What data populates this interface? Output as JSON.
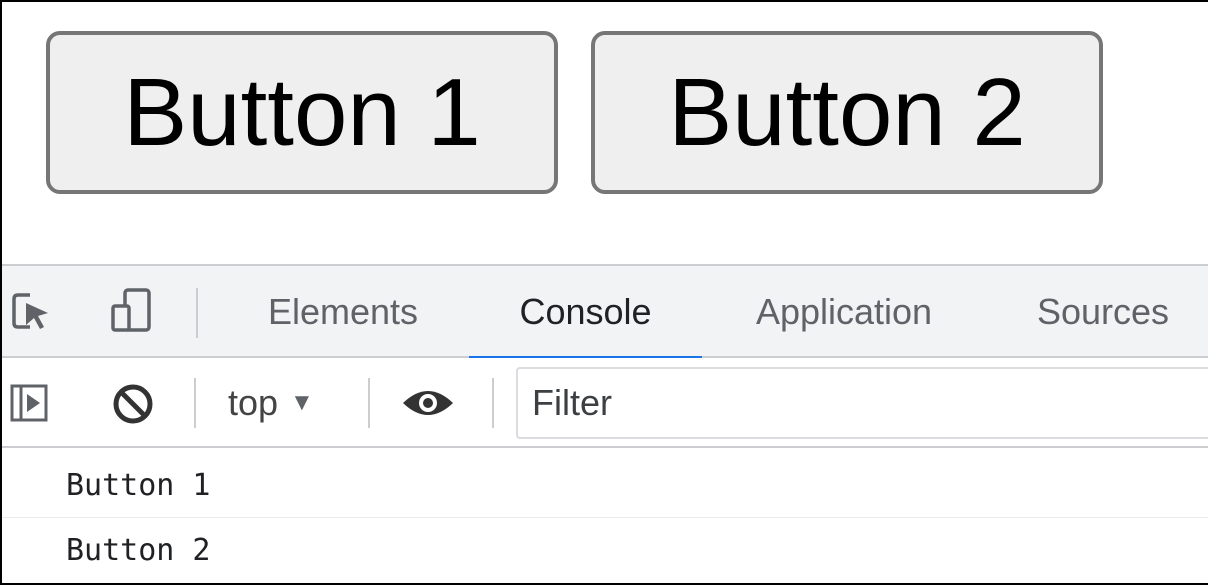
{
  "page": {
    "buttons": [
      {
        "label": "Button 1"
      },
      {
        "label": "Button 2"
      }
    ]
  },
  "devtools": {
    "tabs": [
      {
        "label": "Elements",
        "active": false
      },
      {
        "label": "Console",
        "active": true
      },
      {
        "label": "Application",
        "active": false
      },
      {
        "label": "Sources",
        "active": false
      }
    ],
    "toolbar": {
      "context": "top",
      "filter_placeholder": "Filter"
    },
    "console_lines": [
      {
        "text": "Button 1"
      },
      {
        "text": "Button 2"
      }
    ],
    "colors": {
      "accent": "#1a73e8",
      "tabbar_bg": "#f1f3f4",
      "border": "#cbcdd1"
    },
    "icons": [
      "inspect-element-icon",
      "device-toolbar-icon",
      "sidebar-toggle-icon",
      "clear-console-icon",
      "live-expression-icon"
    ]
  }
}
